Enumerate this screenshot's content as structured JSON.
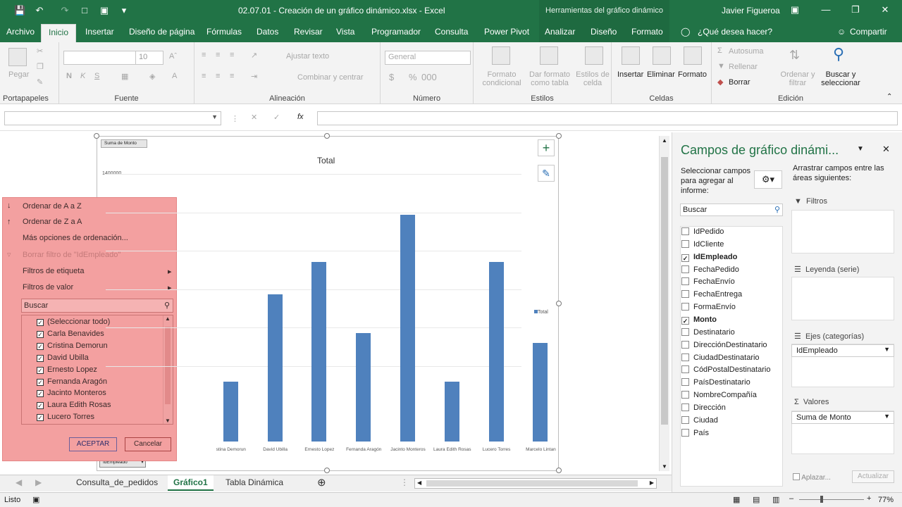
{
  "titlebar": {
    "title": "02.07.01 - Creación de un gráfico dinámico.xlsx - Excel",
    "context_header": "Herramientas del gráfico dinámico",
    "user": "Javier Figueroa"
  },
  "tabs": [
    "Archivo",
    "Inicio",
    "Insertar",
    "Diseño de página",
    "Fórmulas",
    "Datos",
    "Revisar",
    "Vista",
    "Programador",
    "Consulta",
    "Power Pivot",
    "Analizar",
    "Diseño",
    "Formato"
  ],
  "tellme": "¿Qué desea hacer?",
  "share": "Compartir",
  "ribbon": {
    "portapapeles": "Portapapeles",
    "pegar": "Pegar",
    "fuente": "Fuente",
    "font_size": "10",
    "alineacion": "Alineación",
    "ajustar": "Ajustar texto",
    "combinar": "Combinar y centrar",
    "numero": "Número",
    "general": "General",
    "estilos": "Estilos",
    "formato_cond": "Formato condicional",
    "dar_formato": "Dar formato como tabla",
    "estilos_celda": "Estilos de celda",
    "celdas": "Celdas",
    "insertar": "Insertar",
    "eliminar": "Eliminar",
    "formato": "Formato",
    "edicion": "Edición",
    "autosuma": "Autosuma",
    "rellenar": "Rellenar",
    "borrar": "Borrar",
    "ordenar": "Ordenar y filtrar",
    "buscar": "Buscar y seleccionar"
  },
  "formula_bar": {
    "fx": "fx"
  },
  "chart_data": {
    "type": "bar",
    "title": "Total",
    "field_button_top": "Suma de Monto",
    "field_button_bottom": "IdEmpleado",
    "y_tick_top": "1400000",
    "legend": "Total",
    "categories": [
      "Carla Benavides",
      "Cristina Demorun",
      "David Ubilla",
      "Ernesto Lopez",
      "Fernanda Aragón",
      "Jacinto Monteros",
      "Laura Edith Rosas",
      "Lucero Torres",
      "Marcelo Lintan"
    ],
    "visible_labels": [
      "stina Demorun",
      "David Ubilla",
      "Ernesto Lopez",
      "Fernanda Aragón",
      "Jacinto Monteros",
      "Laura Edith Rosas",
      "Lucero Torres",
      "Marcelo Lintan"
    ],
    "values": [
      null,
      370000,
      910000,
      1110000,
      670000,
      1400000,
      370000,
      1110000,
      610000
    ],
    "ylim": [
      0,
      1700000
    ]
  },
  "popup": {
    "sort_az": "Ordenar de A a Z",
    "sort_za": "Ordenar de Z a A",
    "more_sort": "Más opciones de ordenación...",
    "clear_filter": "Borrar filtro de \"IdEmpleado\"",
    "label_filters": "Filtros de etiqueta",
    "value_filters": "Filtros de valor",
    "search_placeholder": "Buscar",
    "items": [
      "(Seleccionar todo)",
      "Carla Benavides",
      "Cristina Demorun",
      "David Ubilla",
      "Ernesto Lopez",
      "Fernanda Aragón",
      "Jacinto Monteros",
      "Laura Edith Rosas",
      "Lucero Torres"
    ],
    "ok": "ACEPTAR",
    "cancel": "Cancelar"
  },
  "sheet_tabs": [
    "Consulta_de_pedidos",
    "Gráfico1",
    "Tabla Dinámica"
  ],
  "status": {
    "ready": "Listo",
    "zoom": "77%"
  },
  "panel": {
    "title": "Campos de gráfico dinámi...",
    "select_label": "Seleccionar campos para agregar al informe:",
    "drag_label": "Arrastrar campos entre las áreas siguientes:",
    "search_placeholder": "Buscar",
    "fields": [
      "IdPedido",
      "IdCliente",
      "IdEmpleado",
      "FechaPedido",
      "FechaEnvío",
      "FechaEntrega",
      "FormaEnvío",
      "Monto",
      "Destinatario",
      "DirecciónDestinatario",
      "CiudadDestinatario",
      "CódPostalDestinatario",
      "PaísDestinatario",
      "NombreCompañía",
      "Dirección",
      "Ciudad",
      "País"
    ],
    "filtros": "Filtros",
    "leyenda": "Leyenda (serie)",
    "ejes": "Ejes (categorías)",
    "ejes_value": "IdEmpleado",
    "valores": "Valores",
    "valores_value": "Suma de Monto",
    "aplazar": "Aplazar...",
    "actualizar": "Actualizar"
  },
  "colors": {
    "excel_green": "#217346",
    "bar": "#4f81bd",
    "popup": "#f3a0a0"
  }
}
